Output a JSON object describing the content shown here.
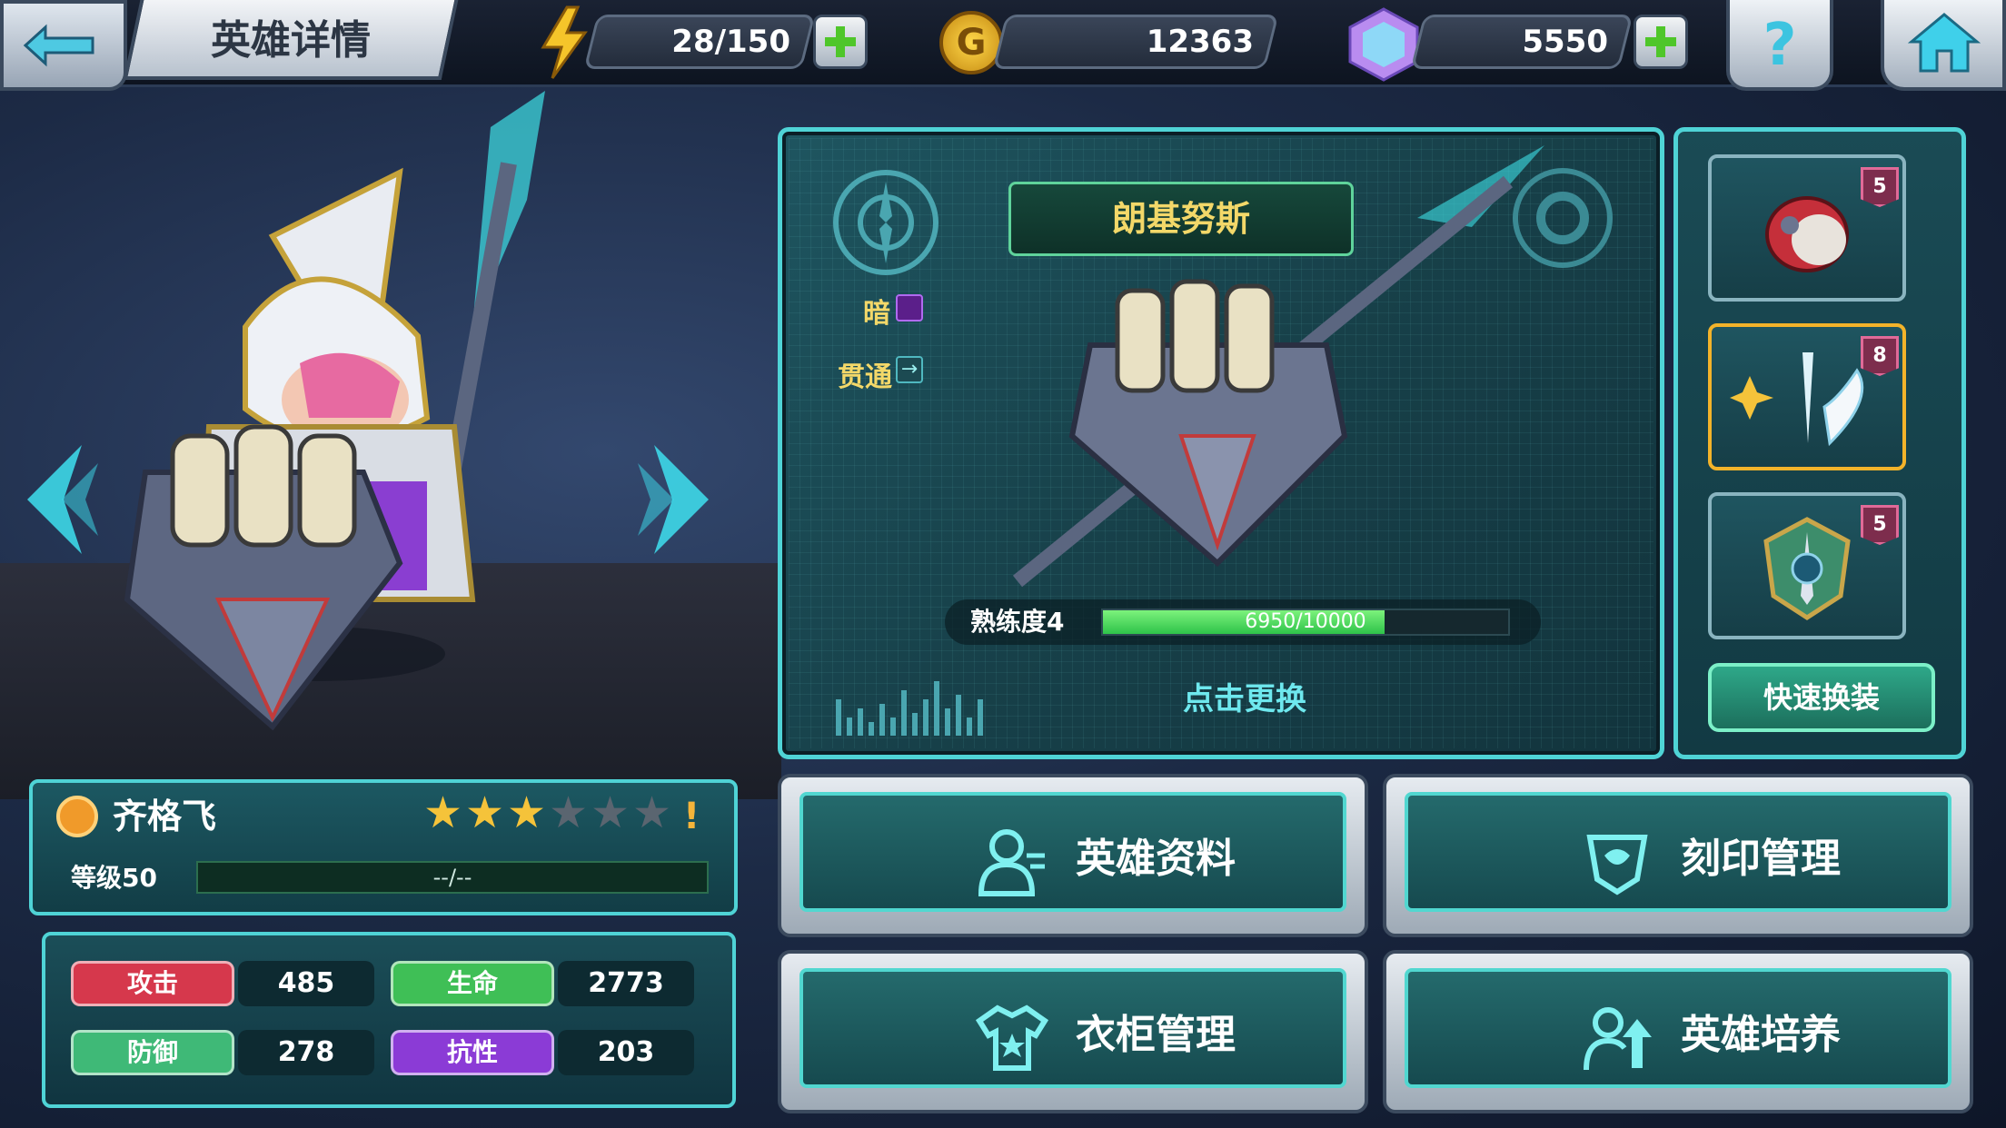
{
  "header": {
    "title": "英雄详情",
    "energy": "28/150",
    "gold": "12363",
    "gems": "5550",
    "help_symbol": "?"
  },
  "weapon": {
    "name": "朗基努斯",
    "element": "暗",
    "trait": "贯通",
    "proficiency_label": "熟练度4",
    "proficiency_text": "6950/10000",
    "proficiency_value": 6950,
    "proficiency_max": 10000,
    "replace_label": "点击更换"
  },
  "slots": [
    {
      "badge": "5",
      "icon": "helmet-icon"
    },
    {
      "badge": "8",
      "icon": "wings-icon"
    },
    {
      "badge": "5",
      "icon": "emblem-icon"
    }
  ],
  "quick_equip_label": "快速换装",
  "hero": {
    "name": "齐格飞",
    "stars_filled": 3,
    "stars_total": 6,
    "alert": "!",
    "level_label": "等级50",
    "level_progress": "--/--"
  },
  "stats": [
    {
      "label": "攻击",
      "value": "485",
      "color": "#d6384c"
    },
    {
      "label": "生命",
      "value": "2773",
      "color": "#3fbf56"
    },
    {
      "label": "防御",
      "value": "278",
      "color": "#3fb977"
    },
    {
      "label": "抗性",
      "value": "203",
      "color": "#8b3bd6"
    }
  ],
  "menu": {
    "hero_info": "英雄资料",
    "engraving": "刻印管理",
    "wardrobe": "衣柜管理",
    "training": "英雄培养"
  },
  "colors": {
    "accent_cyan": "#4fd3d6",
    "gold_text": "#f3d869",
    "progress_green": "#2ec34a"
  }
}
